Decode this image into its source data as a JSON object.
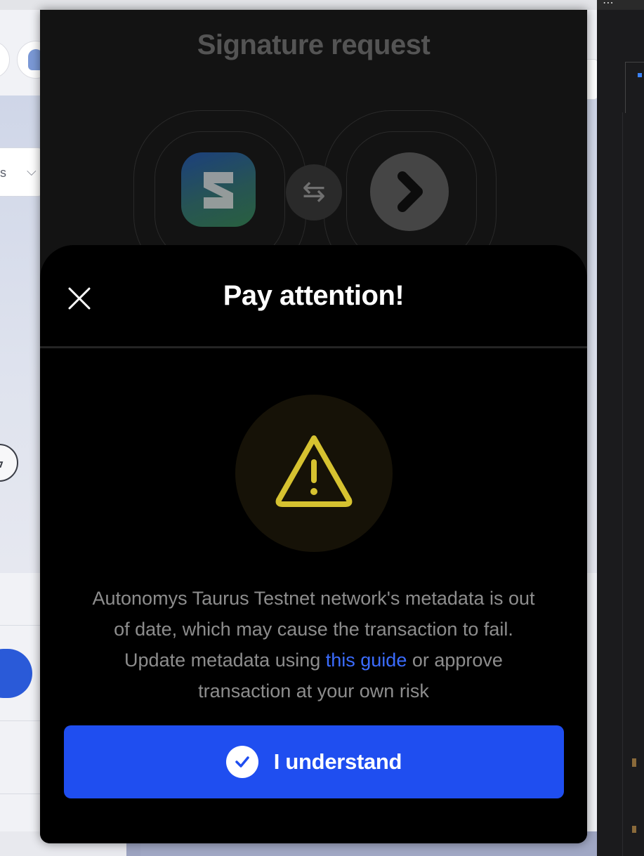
{
  "background_page": {
    "select_text": "s",
    "select_chevron": "chevron-down-icon",
    "bolt_icon": "lightning-icon"
  },
  "right_panel": {
    "menu_dots": "⋯"
  },
  "popup": {
    "title": "Signature request",
    "left_logo_icon": "subwallet-logo",
    "connection_icon": "swap-arrows-icon",
    "right_logo_icon": "chevron-right-icon",
    "arrows_glyph": "⇆"
  },
  "attention": {
    "title": "Pay attention!",
    "close_icon": "close-icon",
    "warning_icon": "warning-triangle-icon",
    "message_before_link": "Autonomys Taurus Testnet network's metadata is out of date, which may cause the transaction to fail. Update metadata using ",
    "link_text": "this guide",
    "message_after_link": " or approve transaction at your own risk",
    "button_label": "I understand",
    "button_icon": "check-circle-icon"
  },
  "colors": {
    "button_blue": "#1f4ef0",
    "link_blue": "#3b6cff",
    "warning_yellow": "#d6c230",
    "sheet_black": "#000000"
  }
}
